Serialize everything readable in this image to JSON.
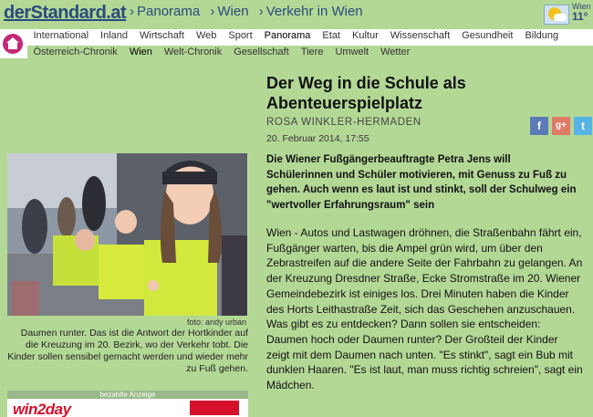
{
  "header": {
    "logo": "derStandard.at",
    "breadcrumbs": [
      "Panorama",
      "Wien",
      "Verkehr in Wien"
    ],
    "separator": "›",
    "weather": {
      "city": "Wien",
      "temp": "11°",
      "icon": "partly-sunny-icon"
    }
  },
  "nav": {
    "home_icon": "home-icon",
    "main": [
      "International",
      "Inland",
      "Wirtschaft",
      "Web",
      "Sport",
      "Panorama",
      "Etat",
      "Kultur",
      "Wissenschaft",
      "Gesundheit",
      "Bildung"
    ],
    "main_active": "Panorama",
    "sub": [
      "Österreich-Chronik",
      "Wien",
      "Welt-Chronik",
      "Gesellschaft",
      "Tiere",
      "Umwelt",
      "Wetter"
    ],
    "sub_active": "Wien"
  },
  "article": {
    "headline": "Der Weg in die Schule als Abenteuerspielplatz",
    "author": "ROSA WINKLER-HERMADEN",
    "date": "20. Februar 2014, 17:55",
    "lead": "Die Wiener Fußgängerbeauftragte Petra Jens will Schülerinnen und Schüler motivieren, mit Genuss zu Fuß zu gehen. Auch wenn es laut ist und stinkt, soll der Schulweg ein \"wertvoller Erfahrungsraum\" sein",
    "body": "Wien - Autos und Lastwagen dröhnen, die Straßenbahn fährt ein, Fußgänger warten, bis die Ampel grün wird, um über den Zebrastreifen auf die andere Seite der Fahrbahn zu gelangen. An der Kreuzung Dresdner Straße, Ecke Stromstraße im 20. Wiener Gemeindebezirk ist einiges los. Drei Minuten haben die Kinder des Horts Leithastraße Zeit, sich das Geschehen anzuschauen. Was gibt es zu entdecken? Dann sollen sie entscheiden: Daumen hoch oder Daumen runter? Der Großteil der Kinder zeigt mit dem Daumen nach unten. \"Es stinkt\", sagt ein Bub mit dunklen Haaren. \"Es ist laut, man muss richtig schreien\", sagt ein Mädchen.",
    "social": {
      "facebook": "f",
      "googleplus": "g+",
      "twitter": "t"
    }
  },
  "photo": {
    "credit": "foto: andy urban",
    "caption": "Daumen runter. Das ist die Antwort der Hortkinder auf die Kreuzung im 20. Bezirk, wo der Verkehr tobt. Die Kinder sollen sensibel gemacht werden und wieder mehr zu Fuß gehen."
  },
  "ad": {
    "label": "bezahlte Anzeige",
    "brand": "win2day"
  },
  "colors": {
    "page_bg": "#b3d896",
    "link": "#2a4b7c",
    "home": "#c3287a"
  }
}
